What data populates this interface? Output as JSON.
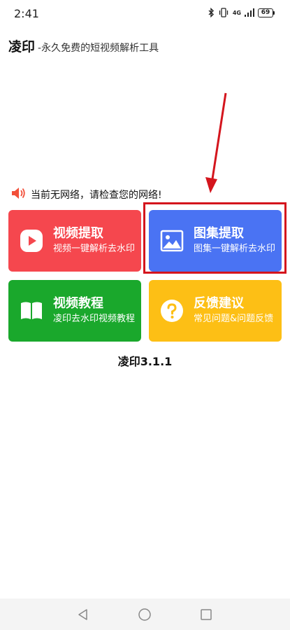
{
  "status_bar": {
    "time": "2:41",
    "network_label": "4G",
    "battery_level": "69"
  },
  "header": {
    "title": "凌印",
    "subtitle": "-永久免费的短视频解析工具"
  },
  "notice": {
    "text": "当前无网络，请检查您的网络!",
    "icon": "speaker-icon"
  },
  "cards": [
    {
      "id": "video",
      "title": "视频提取",
      "desc": "视频一键解析去水印",
      "icon": "play-icon",
      "color": "#f5474e"
    },
    {
      "id": "album",
      "title": "图集提取",
      "desc": "图集一键解析去水印",
      "icon": "image-icon",
      "color": "#4a73f3"
    },
    {
      "id": "tutorial",
      "title": "视频教程",
      "desc": "凌印去水印视频教程",
      "icon": "book-icon",
      "color": "#1aa82c"
    },
    {
      "id": "feedback",
      "title": "反馈建议",
      "desc": "常见问题&问题反馈",
      "icon": "question-icon",
      "color": "#fdbf15"
    }
  ],
  "version": "凌印3.1.1",
  "annotation": {
    "color": "#d4151d"
  }
}
